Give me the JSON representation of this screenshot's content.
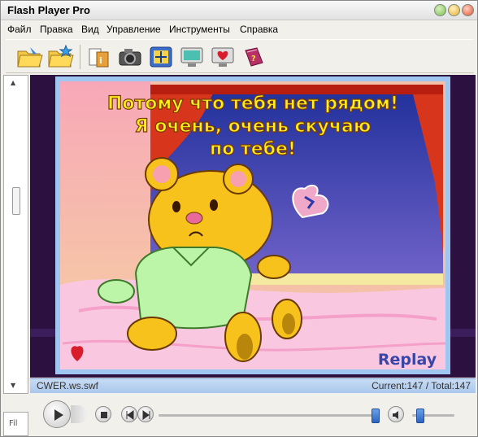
{
  "window": {
    "title": "Flash Player Pro"
  },
  "menu": [
    "Файл",
    "Правка",
    "Вид",
    "Управление",
    "Инструменты",
    "Справка"
  ],
  "toolbar": {
    "buttons": [
      {
        "name": "open-folder-icon"
      },
      {
        "name": "favorites-folder-icon"
      },
      {
        "name": "file-info-icon"
      },
      {
        "name": "camera-icon"
      },
      {
        "name": "fit-screen-icon"
      },
      {
        "name": "fullscreen-monitor-icon"
      },
      {
        "name": "screensaver-heart-icon"
      },
      {
        "name": "help-book-icon"
      }
    ]
  },
  "stage": {
    "banner_lines": [
      "Потому что тебя нет рядом!",
      "Я очень, очень скучаю",
      "по тебе!"
    ],
    "replay_label": "Replay"
  },
  "status": {
    "file": "CWER.ws.swf",
    "position": "Current:147 / Total:147"
  },
  "playback": {
    "progress_fraction": 0.98,
    "volume_fraction": 0.2
  },
  "left_tab": {
    "label": "Fil"
  },
  "colors": {
    "status_bar": "#aac7ec",
    "banner_text": "#ffef1a",
    "accent_blue": "#2e64c0"
  }
}
